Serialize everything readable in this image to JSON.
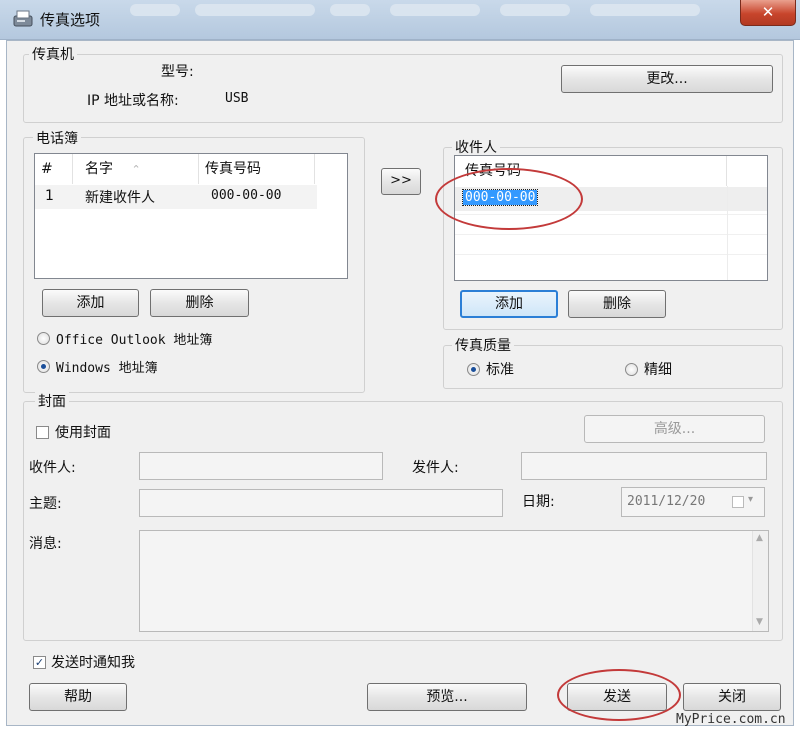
{
  "window": {
    "title": "传真选项",
    "close_glyph": "✕"
  },
  "fax_machine": {
    "group_label": "传真机",
    "model_label": "型号:",
    "model_value": "",
    "ip_label": "IP 地址或名称:",
    "ip_value": "USB",
    "change_button": "更改..."
  },
  "phonebook": {
    "group_label": "电话簿",
    "columns": [
      "#",
      "名字",
      "传真号码"
    ],
    "sort_glyph": "⌃",
    "rows": [
      {
        "index": "1",
        "name": "新建收件人",
        "fax": "000-00-00"
      }
    ],
    "add_button": "添加",
    "delete_button": "删除",
    "source_options": [
      {
        "label": "Office Outlook 地址簿",
        "selected": false
      },
      {
        "label": "Windows 地址簿",
        "selected": true
      }
    ]
  },
  "transfer_button": ">>",
  "recipients": {
    "group_label": "收件人",
    "column_header": "传真号码",
    "rows": [
      "000-00-00"
    ],
    "add_button": "添加",
    "delete_button": "删除"
  },
  "quality": {
    "group_label": "传真质量",
    "options": [
      {
        "label": "标准",
        "selected": true
      },
      {
        "label": "精细",
        "selected": false
      }
    ]
  },
  "cover": {
    "group_label": "封面",
    "use_cover_label": "使用封面",
    "use_cover_checked": false,
    "advanced_button": "高级...",
    "recipient_label": "收件人:",
    "sender_label": "发件人:",
    "subject_label": "主题:",
    "date_label": "日期:",
    "date_value": "2011/12/20",
    "message_label": "消息:"
  },
  "notify": {
    "label": "发送时通知我",
    "checked": true
  },
  "footer": {
    "help_button": "帮助",
    "preview_button": "预览...",
    "send_button": "发送",
    "close_button": "关闭"
  },
  "watermark": "MyPrice.com.cn",
  "colors": {
    "annotation": "#c33a3a",
    "selection": "#3399ff"
  }
}
